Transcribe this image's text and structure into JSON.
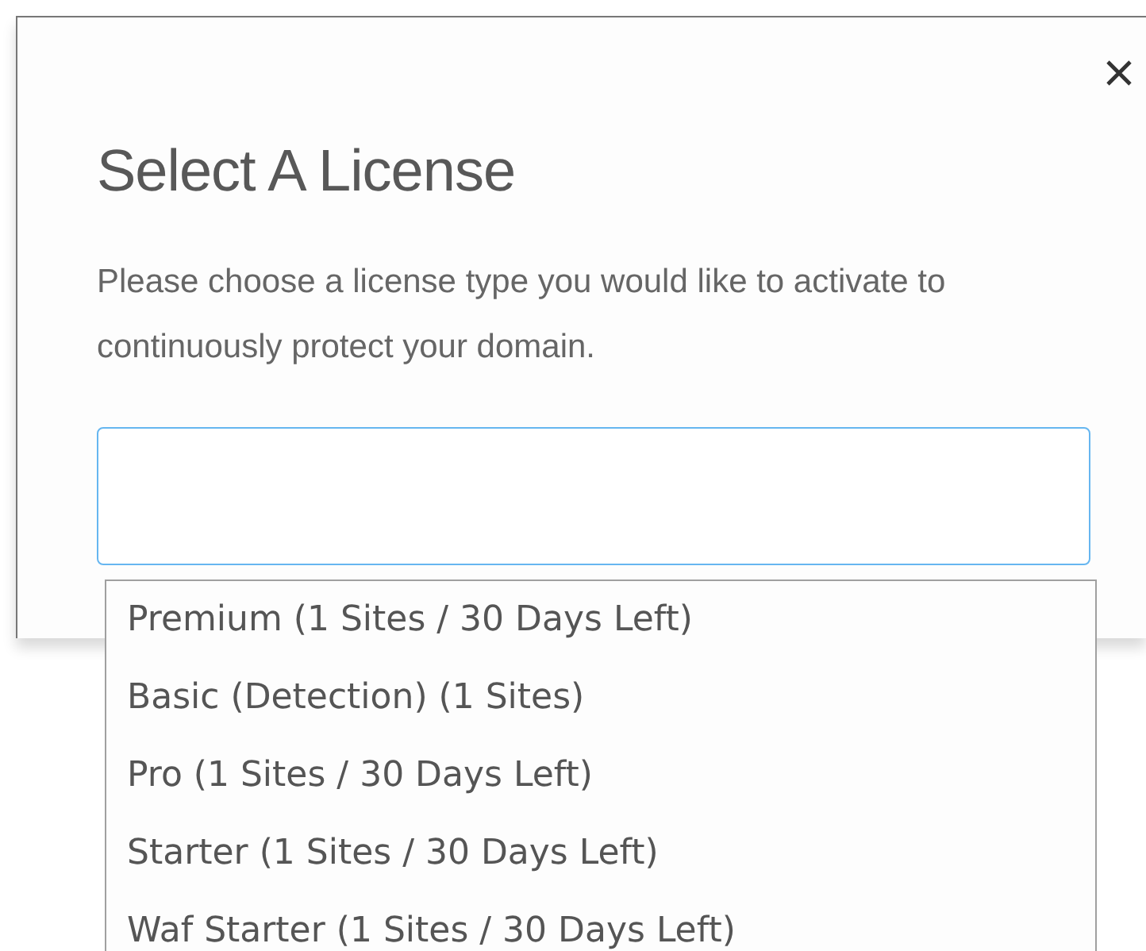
{
  "dialog": {
    "title": "Select A License",
    "description": "Please choose a license type you would like to activate to continuously protect your domain.",
    "options": [
      {
        "label": "Premium (1 Sites / 30 Days Left)"
      },
      {
        "label": "Basic (Detection) (1 Sites)"
      },
      {
        "label": "Pro (1 Sites / 30 Days Left)"
      },
      {
        "label": "Starter (1 Sites / 30 Days Left)"
      },
      {
        "label": "Waf Starter (1 Sites / 30 Days Left)"
      }
    ]
  }
}
